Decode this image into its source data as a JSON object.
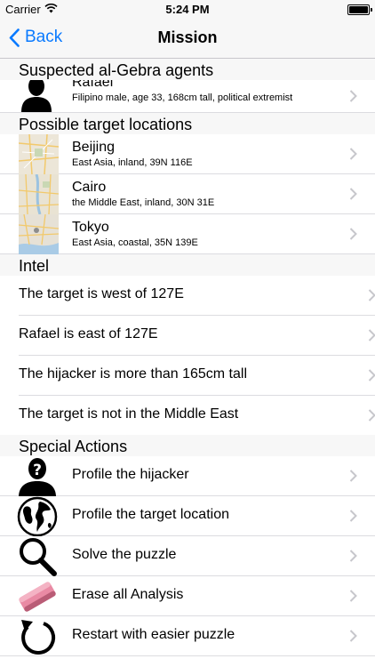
{
  "status": {
    "carrier": "Carrier",
    "time": "5:24 PM"
  },
  "nav": {
    "back_label": "Back",
    "title": "Mission"
  },
  "sections": {
    "agents": {
      "header": "Suspected al-Gebra agents",
      "items": [
        {
          "name": "Rafael",
          "desc": "Filipino male, age 33, 168cm tall, political extremist",
          "icon": "person-silhouette-icon"
        }
      ]
    },
    "locations": {
      "header": "Possible target locations",
      "items": [
        {
          "name": "Beijing",
          "desc": "East Asia, inland, 39N 116E",
          "icon": "map-thumbnail"
        },
        {
          "name": "Cairo",
          "desc": "the Middle East, inland, 30N 31E",
          "icon": "map-thumbnail"
        },
        {
          "name": "Tokyo",
          "desc": "East Asia, coastal, 35N 139E",
          "icon": "map-thumbnail"
        }
      ]
    },
    "intel": {
      "header": "Intel",
      "items": [
        "The target is west of 127E",
        "Rafael is east of 127E",
        "The hijacker is more than 165cm tall",
        "The target is not in the Middle East"
      ]
    },
    "actions": {
      "header": "Special Actions",
      "items": [
        {
          "label": "Profile the hijacker",
          "icon": "unknown-person-icon"
        },
        {
          "label": "Profile the target location",
          "icon": "globe-icon"
        },
        {
          "label": "Solve the puzzle",
          "icon": "magnifier-icon"
        },
        {
          "label": "Erase all Analysis",
          "icon": "eraser-icon"
        },
        {
          "label": "Restart with easier puzzle",
          "icon": "restart-icon"
        }
      ]
    }
  },
  "colors": {
    "accent": "#0a7aff",
    "header_bg": "#f7f7f7",
    "separator": "#dcdce0",
    "chevron": "#c7c7cc"
  }
}
